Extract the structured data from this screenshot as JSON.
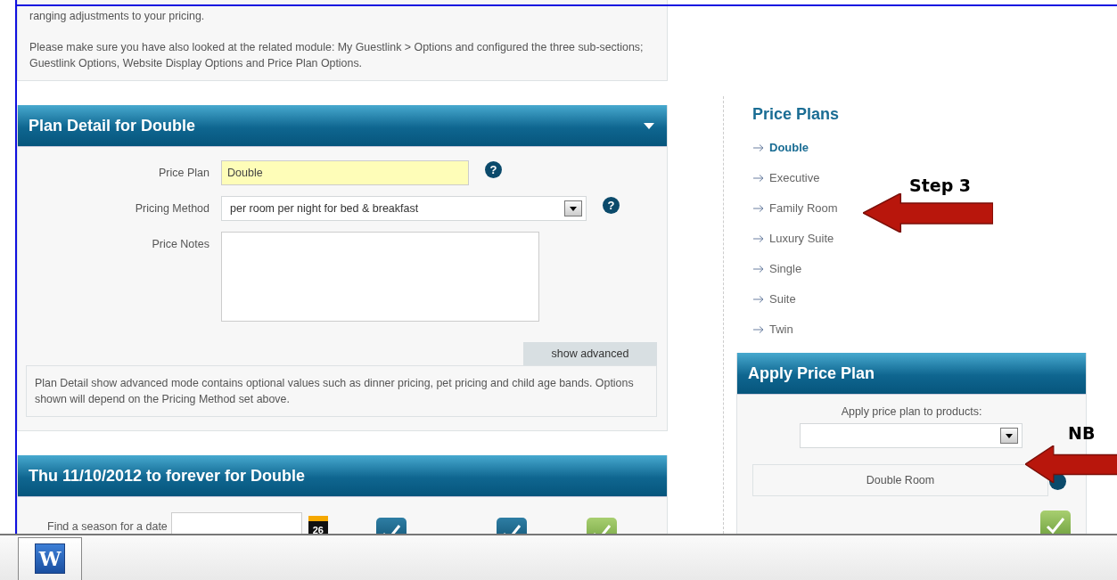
{
  "notice": {
    "paragraphs": [
      "ranging adjustments to your pricing.",
      "Please make sure you have also looked at the related module: My Guestlink > Options and configured the three sub-sections; Guestlink Options, Website Display Options and Price Plan Options."
    ]
  },
  "plan_detail": {
    "title": "Plan Detail for Double",
    "expanded": true,
    "fields": [
      {
        "kind": "input",
        "label": "Price Plan",
        "value": "Double",
        "hint": "?"
      },
      {
        "kind": "select",
        "label": "Pricing Method",
        "value": "per room per night for bed & breakfast",
        "hint": "?"
      },
      {
        "kind": "textarea",
        "label": "Price Notes"
      }
    ],
    "show_advanced": "show advanced",
    "note": "Plan Detail show advanced mode contains optional values such as dinner pricing, pet pricing and child age bands. Options shown will depend on the Pricing Method set above."
  },
  "season": {
    "title": "Thu 11/10/2012 to forever for Double",
    "find_label": "Find a season for a date",
    "calendar_day": "26",
    "buttons": [
      {
        "kind": "dark"
      },
      {
        "kind": "dark"
      },
      {
        "kind": "light"
      }
    ]
  },
  "price_plans": {
    "title": "Price Plans",
    "items": [
      {
        "label": "Double",
        "selected": true
      },
      {
        "label": "Executive",
        "selected": false
      },
      {
        "label": "Family Room",
        "selected": false
      },
      {
        "label": "Luxury Suite",
        "selected": false
      },
      {
        "label": "Single",
        "selected": false
      },
      {
        "label": "Suite",
        "selected": false
      },
      {
        "label": "Twin",
        "selected": false
      }
    ]
  },
  "apply": {
    "title": "Apply Price Plan",
    "label": "Apply price plan to products:",
    "products": [
      "Double Room"
    ]
  },
  "annotations": [
    {
      "text": "Step 3"
    },
    {
      "text": "NB"
    }
  ],
  "taskbar": {
    "apps": [
      {
        "letter": "W"
      }
    ]
  }
}
